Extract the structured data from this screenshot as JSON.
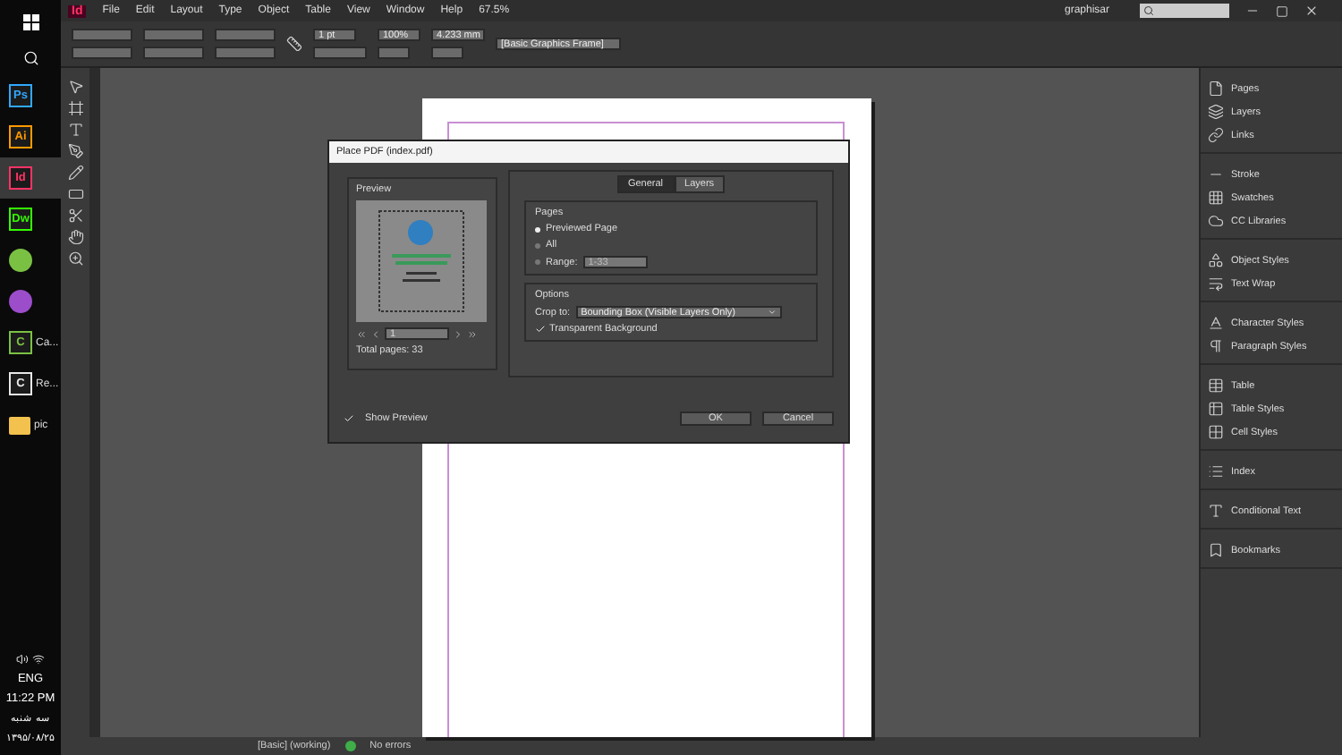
{
  "taskbar": {
    "apps": [
      {
        "kind": "tile",
        "glyph": "Ps",
        "color": "#31a8ff",
        "selected": false
      },
      {
        "kind": "tile",
        "glyph": "Ai",
        "color": "#ff9a00",
        "selected": false
      },
      {
        "kind": "tile",
        "glyph": "Id",
        "color": "#ff3366",
        "selected": true
      },
      {
        "kind": "tile",
        "glyph": "Dw",
        "color": "#35fa00",
        "selected": false
      },
      {
        "kind": "circle",
        "color": "#7ac143",
        "selected": false
      },
      {
        "kind": "circle",
        "color": "#9b4dca",
        "selected": false
      },
      {
        "kind": "tile",
        "glyph": "C",
        "label": "Ca...",
        "color": "#7ac143",
        "selected": false
      },
      {
        "kind": "tile",
        "glyph": "C",
        "label": "Re...",
        "color": "#e8e8e8",
        "selected": false
      },
      {
        "kind": "folder",
        "label": "pic",
        "color": "#f2c14e",
        "selected": false
      }
    ],
    "language": "ENG",
    "time": "11:22 PM",
    "day": "سه شنبه",
    "date": "۱۳۹۵/۰۸/۲۵"
  },
  "app_logo": "Id",
  "menu": [
    "File",
    "Edit",
    "Layout",
    "Type",
    "Object",
    "Table",
    "View",
    "Window",
    "Help"
  ],
  "zoom": "67.5%",
  "workspace": "graphisar",
  "control_bar": {
    "stroke_weight": "1 pt",
    "opacity": "100%",
    "size": "4.233 mm",
    "frame_style": "[Basic Graphics Frame]"
  },
  "dialog": {
    "title": "Place PDF (index.pdf)",
    "preview_label": "Preview",
    "page_field": "1",
    "total_pages": "Total pages: 33",
    "tabs": [
      {
        "label": "General",
        "selected": true
      },
      {
        "label": "Layers",
        "selected": false
      }
    ],
    "pages": {
      "title": "Pages",
      "options": [
        {
          "label": "Previewed Page",
          "selected": true
        },
        {
          "label": "All",
          "selected": false
        },
        {
          "label": "Range:",
          "selected": false
        }
      ],
      "range_value": "1-33"
    },
    "options": {
      "title": "Options",
      "crop_label": "Crop to:",
      "crop_value": "Bounding Box (Visible Layers Only)",
      "transparent": {
        "label": "Transparent Background",
        "checked": true
      }
    },
    "show_preview": {
      "label": "Show Preview",
      "checked": true
    },
    "buttons": [
      "OK",
      "Cancel"
    ]
  },
  "panels": [
    [
      "Pages",
      "Layers",
      "Links"
    ],
    [
      "Stroke",
      "Swatches",
      "CC Libraries"
    ],
    [
      "Object Styles",
      "Text Wrap"
    ],
    [
      "Character Styles",
      "Paragraph Styles"
    ],
    [
      "Table",
      "Table Styles",
      "Cell Styles"
    ],
    [
      "Index"
    ],
    [
      "Conditional Text"
    ],
    [
      "Bookmarks"
    ]
  ],
  "status_bar": {
    "style": "[Basic] (working)",
    "preflight": "No errors"
  }
}
